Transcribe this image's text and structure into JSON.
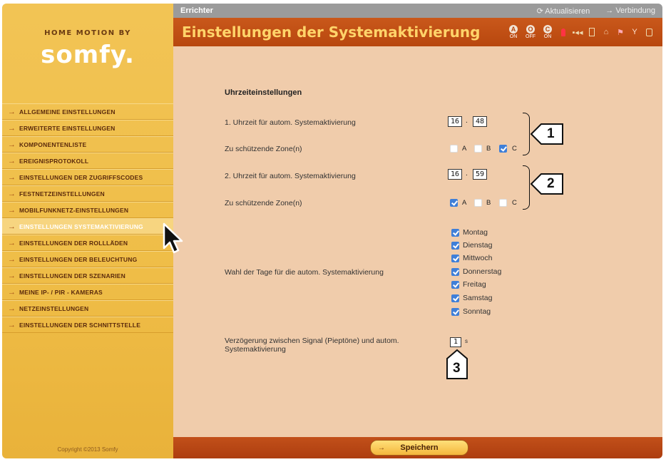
{
  "brand": {
    "tagline": "HOME MOTION BY",
    "logo_text": "somfy."
  },
  "sidebar": {
    "items": [
      {
        "label": "ALLGEMEINE EINSTELLUNGEN",
        "active": false
      },
      {
        "label": "ERWEITERTE EINSTELLUNGEN",
        "active": false
      },
      {
        "label": "KOMPONENTENLISTE",
        "active": false
      },
      {
        "label": "EREIGNISPROTOKOLL",
        "active": false
      },
      {
        "label": "EINSTELLUNGEN DER ZUGRIFFSCODES",
        "active": false
      },
      {
        "label": "FESTNETZEINSTELLUNGEN",
        "active": false
      },
      {
        "label": "MOBILFUNKNETZ-EINSTELLUNGEN",
        "active": false
      },
      {
        "label": "EINSTELLUNGEN SYSTEMAKTIVIERUNG",
        "active": true
      },
      {
        "label": "EINSTELLUNGEN DER ROLLLÄDEN",
        "active": false
      },
      {
        "label": "EINSTELLUNGEN DER BELEUCHTUNG",
        "active": false
      },
      {
        "label": "EINSTELLUNGEN DER SZENARIEN",
        "active": false
      },
      {
        "label": "MEINE IP- / PIR - KAMERAS",
        "active": false
      },
      {
        "label": "NETZEINSTELLUNGEN",
        "active": false
      },
      {
        "label": "EINSTELLUNGEN DER SCHNITTSTELLE",
        "active": false
      }
    ],
    "copyright": "Copyright ©2013 Somfy"
  },
  "topbar": {
    "title": "Errichter",
    "refresh_label": "Aktualisieren",
    "connection_label": "Verbindung"
  },
  "header": {
    "page_title": "Einstellungen der Systemaktivierung",
    "modes": [
      {
        "symbol": "A",
        "label": "ON"
      },
      {
        "symbol": "O",
        "label": "OFF"
      },
      {
        "symbol": "C",
        "label": "ON"
      }
    ],
    "status_icons": [
      "lamp-icon",
      "signal-icon",
      "door-icon",
      "house-icon",
      "flag-icon",
      "antenna-icon",
      "battery-icon"
    ]
  },
  "settings": {
    "section_title": "Uhrzeiteinstellungen",
    "time1": {
      "label": "1. Uhrzeit für autom. Systemaktivierung",
      "hour": "16",
      "minute": "48"
    },
    "zones1": {
      "label": "Zu schützende Zone(n)",
      "A": false,
      "B": false,
      "C": true
    },
    "time2": {
      "label": "2. Uhrzeit für autom. Systemaktivierung",
      "hour": "16",
      "minute": "59"
    },
    "zones2": {
      "label": "Zu schützende Zone(n)",
      "A": true,
      "B": false,
      "C": false
    },
    "days": {
      "label": "Wahl der Tage für die autom. Systemaktivierung",
      "items": [
        {
          "name": "Montag",
          "checked": true
        },
        {
          "name": "Dienstag",
          "checked": true
        },
        {
          "name": "Mittwoch",
          "checked": true
        },
        {
          "name": "Donnerstag",
          "checked": true
        },
        {
          "name": "Freitag",
          "checked": true
        },
        {
          "name": "Samstag",
          "checked": true
        },
        {
          "name": "Sonntag",
          "checked": true
        }
      ]
    },
    "delay": {
      "label": "Verzögerung zwischen Signal (Pieptöne) und autom. Systemaktivierung",
      "value": "1",
      "unit": "s"
    }
  },
  "zone_letters": {
    "a": "A",
    "b": "B",
    "c": "C"
  },
  "time_separator": ".",
  "callouts": {
    "one": "1",
    "two": "2",
    "three": "3"
  },
  "footer": {
    "save_label": "Speichern"
  },
  "colors": {
    "sidebar": "#efbd47",
    "header": "#b8470e",
    "content": "#f0ccab",
    "accent": "#3f7fd8"
  }
}
